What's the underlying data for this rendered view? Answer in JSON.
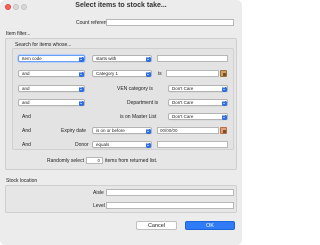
{
  "window": {
    "title": "Select items to stock take..."
  },
  "count_reference": {
    "label": "Count reference",
    "value": ""
  },
  "item_filter": {
    "label": "Item filter...",
    "search_label": "Search for items whose...",
    "rows": [
      {
        "prefix": "",
        "field": "Item code",
        "operator": "starts with",
        "value": ""
      },
      {
        "prefix": "and",
        "field": "Category 1",
        "middle": "is",
        "value": ""
      },
      {
        "prefix": "and",
        "middle": "VEN category is",
        "value_select": "Don't Care"
      },
      {
        "prefix": "and",
        "middle": "Department is",
        "value_select": "Don't Care"
      },
      {
        "prefix": "And",
        "middle": "is on Master List",
        "value_select": "Don't Care"
      },
      {
        "prefix": "And",
        "middle": "Expiry date",
        "operator": "is on or before",
        "value": "00/00/00"
      },
      {
        "prefix": "And",
        "middle": "Donor",
        "operator": "equals",
        "value": ""
      }
    ],
    "random_select": {
      "label_before": "Randomly select",
      "value": "0",
      "label_after": "items from returned list."
    }
  },
  "stock_location": {
    "label": "Stock location",
    "aisle_label": "Aisle",
    "aisle_value": "",
    "level_label": "Level",
    "level_value": ""
  },
  "buttons": {
    "cancel": "Cancel",
    "ok": "OK"
  },
  "colors": {
    "accent": "#2f7cf6",
    "close": "#ff5f57"
  },
  "icons": [
    "lookup-icon",
    "calendar-icon"
  ]
}
